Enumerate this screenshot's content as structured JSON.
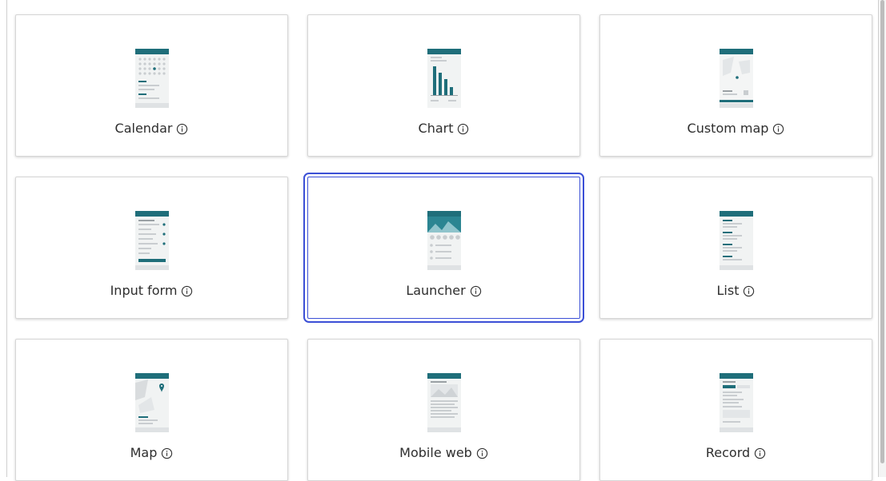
{
  "templates": [
    {
      "label": "Calendar",
      "thumbnail": "calendar-thumbnail",
      "selected": false
    },
    {
      "label": "Chart",
      "thumbnail": "chart-thumbnail",
      "selected": false
    },
    {
      "label": "Custom map",
      "thumbnail": "custom-map-thumbnail",
      "selected": false
    },
    {
      "label": "Input form",
      "thumbnail": "input-form-thumbnail",
      "selected": false
    },
    {
      "label": "Launcher",
      "thumbnail": "launcher-thumbnail",
      "selected": true
    },
    {
      "label": "List",
      "thumbnail": "list-thumbnail",
      "selected": false
    },
    {
      "label": "Map",
      "thumbnail": "map-thumbnail",
      "selected": false
    },
    {
      "label": "Mobile web",
      "thumbnail": "mobile-web-thumbnail",
      "selected": false
    },
    {
      "label": "Record",
      "thumbnail": "record-thumbnail",
      "selected": false
    }
  ],
  "icons": {
    "info": "info-circle-icon"
  },
  "colors": {
    "accent": "#1f6e7a",
    "selection": "#3b4fd6",
    "card_border": "#d6d6d6",
    "text": "#2e2e2e"
  }
}
